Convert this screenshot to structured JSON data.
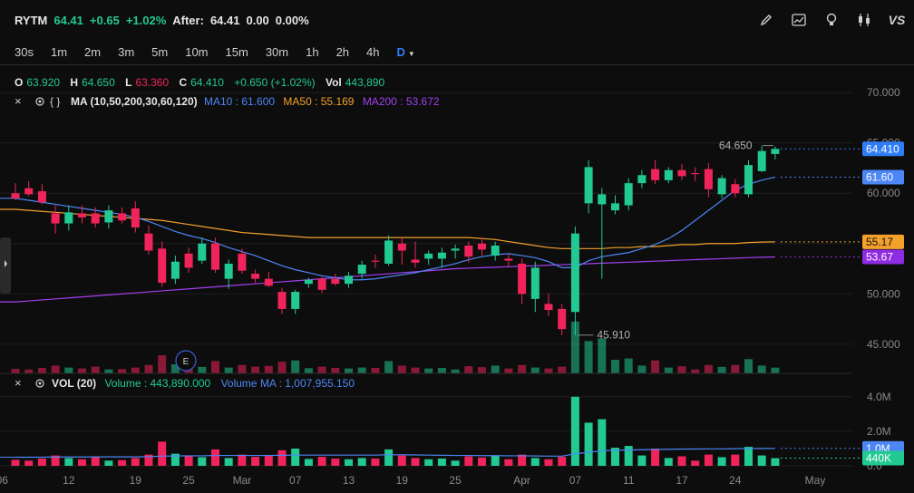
{
  "header": {
    "symbol": "RYTM",
    "last": "64.41",
    "change": "+0.65",
    "change_pct": "+1.02%",
    "after_label": "After:",
    "after_price": "64.41",
    "after_change": "0.00",
    "after_change_pct": "0.00%"
  },
  "toolbar_icons": [
    "pencil-icon",
    "chart-trend-icon",
    "lightbulb-icon",
    "candles-icon",
    "vs-icon"
  ],
  "toolbar": {
    "vs_label": "VS"
  },
  "timeframes": [
    "30s",
    "1m",
    "2m",
    "3m",
    "5m",
    "10m",
    "15m",
    "30m",
    "1h",
    "2h",
    "4h",
    "D"
  ],
  "active_timeframe": "D",
  "ohlc": {
    "o_label": "O",
    "o": "63.920",
    "h_label": "H",
    "h": "64.650",
    "l_label": "L",
    "l": "63.360",
    "c_label": "C",
    "c": "64.410",
    "chg": "+0.650 (+1.02%)",
    "vol_label": "Vol",
    "vol": "443,890"
  },
  "ma_legend": {
    "title": "MA (10,50,200,30,60,120)",
    "ma10": "MA10 : 61.600",
    "ma50": "MA50 : 55.169",
    "ma200": "MA200 : 53.672"
  },
  "vol_legend": {
    "title": "VOL (20)",
    "volume": "Volume : 443,890.000",
    "volume_ma": "Volume MA : 1,007,955.150"
  },
  "colors": {
    "up": "#22c993",
    "down": "#f0245a",
    "ma10": "#4d86f5",
    "ma50": "#f4a12c",
    "ma200": "#a33ff0",
    "last_price_tag": "#2f7df6",
    "ma10_tag": "#4d86f5",
    "ma50_tag": "#f4a12c",
    "ma200_tag": "#8f2be0"
  },
  "chart_data": {
    "type": "candlestick",
    "price_axis": {
      "ticks": [
        "70.000",
        "65.000",
        "60.000",
        "55.000",
        "50.000",
        "45.000"
      ],
      "range": [
        43,
        72
      ]
    },
    "volume_axis": {
      "ticks": [
        "4.0M",
        "2.0M",
        "0.0"
      ],
      "range": [
        0,
        4200000
      ]
    },
    "x_ticks": [
      "06",
      "12",
      "19",
      "25",
      "Mar",
      "07",
      "13",
      "19",
      "25",
      "Apr",
      "07",
      "11",
      "17",
      "24",
      "May"
    ],
    "price_tags": {
      "last": "64.410",
      "ma10": "61.60",
      "ma50": "55.17",
      "ma200": "53.67"
    },
    "volume_tags": {
      "volume_ma": "1.0M",
      "volume": "440K"
    },
    "annotations": {
      "high": "64.650",
      "low": "45.910"
    },
    "earnings_marker": "E",
    "candles": [
      {
        "o": 60.0,
        "h": 61.0,
        "l": 59.3,
        "c": 59.5,
        "v": 350000
      },
      {
        "o": 60.5,
        "h": 61.2,
        "l": 59.7,
        "c": 59.9,
        "v": 300000
      },
      {
        "o": 60.2,
        "h": 60.9,
        "l": 58.9,
        "c": 59.1,
        "v": 420000
      },
      {
        "o": 58.0,
        "h": 58.8,
        "l": 56.0,
        "c": 57.0,
        "v": 600000
      },
      {
        "o": 57.0,
        "h": 58.8,
        "l": 56.3,
        "c": 58.1,
        "v": 450000
      },
      {
        "o": 58.0,
        "h": 58.8,
        "l": 57.0,
        "c": 57.6,
        "v": 380000
      },
      {
        "o": 58.0,
        "h": 58.6,
        "l": 56.6,
        "c": 57.0,
        "v": 520000
      },
      {
        "o": 57.1,
        "h": 58.8,
        "l": 56.5,
        "c": 58.3,
        "v": 300000
      },
      {
        "o": 58.0,
        "h": 58.6,
        "l": 57.0,
        "c": 57.3,
        "v": 330000
      },
      {
        "o": 58.5,
        "h": 59.2,
        "l": 56.1,
        "c": 56.6,
        "v": 450000
      },
      {
        "o": 56.0,
        "h": 56.8,
        "l": 53.9,
        "c": 54.3,
        "v": 650000
      },
      {
        "o": 54.5,
        "h": 55.2,
        "l": 50.7,
        "c": 51.1,
        "v": 1400000
      },
      {
        "o": 51.5,
        "h": 53.8,
        "l": 51.0,
        "c": 53.2,
        "v": 700000
      },
      {
        "o": 54.0,
        "h": 54.6,
        "l": 52.1,
        "c": 52.6,
        "v": 600000
      },
      {
        "o": 53.3,
        "h": 55.6,
        "l": 53.0,
        "c": 55.0,
        "v": 500000
      },
      {
        "o": 55.0,
        "h": 55.6,
        "l": 52.1,
        "c": 52.4,
        "v": 950000
      },
      {
        "o": 51.5,
        "h": 53.4,
        "l": 50.5,
        "c": 53.0,
        "v": 450000
      },
      {
        "o": 54.0,
        "h": 54.5,
        "l": 52.0,
        "c": 52.3,
        "v": 650000
      },
      {
        "o": 52.0,
        "h": 52.4,
        "l": 51.1,
        "c": 51.5,
        "v": 520000
      },
      {
        "o": 51.5,
        "h": 52.2,
        "l": 50.7,
        "c": 50.8,
        "v": 580000
      },
      {
        "o": 50.2,
        "h": 50.6,
        "l": 48.0,
        "c": 48.5,
        "v": 900000
      },
      {
        "o": 48.5,
        "h": 50.4,
        "l": 48.0,
        "c": 50.2,
        "v": 1000000
      },
      {
        "o": 51.0,
        "h": 51.6,
        "l": 50.6,
        "c": 51.4,
        "v": 400000
      },
      {
        "o": 51.5,
        "h": 51.7,
        "l": 50.1,
        "c": 50.4,
        "v": 520000
      },
      {
        "o": 51.5,
        "h": 52.0,
        "l": 50.8,
        "c": 51.0,
        "v": 420000
      },
      {
        "o": 51.0,
        "h": 52.2,
        "l": 50.6,
        "c": 51.8,
        "v": 380000
      },
      {
        "o": 52.0,
        "h": 53.3,
        "l": 51.5,
        "c": 52.9,
        "v": 450000
      },
      {
        "o": 53.3,
        "h": 53.9,
        "l": 52.6,
        "c": 53.2,
        "v": 420000
      },
      {
        "o": 53.0,
        "h": 55.8,
        "l": 52.8,
        "c": 55.3,
        "v": 950000
      },
      {
        "o": 55.0,
        "h": 55.6,
        "l": 52.9,
        "c": 54.3,
        "v": 600000
      },
      {
        "o": 53.4,
        "h": 55.2,
        "l": 52.6,
        "c": 53.1,
        "v": 450000
      },
      {
        "o": 53.5,
        "h": 54.3,
        "l": 52.9,
        "c": 54.0,
        "v": 380000
      },
      {
        "o": 53.5,
        "h": 54.6,
        "l": 52.6,
        "c": 54.1,
        "v": 420000
      },
      {
        "o": 54.3,
        "h": 54.9,
        "l": 53.5,
        "c": 54.5,
        "v": 300000
      },
      {
        "o": 54.8,
        "h": 55.2,
        "l": 53.1,
        "c": 53.7,
        "v": 550000
      },
      {
        "o": 55.0,
        "h": 55.6,
        "l": 53.8,
        "c": 54.4,
        "v": 480000
      },
      {
        "o": 53.8,
        "h": 55.2,
        "l": 53.3,
        "c": 54.8,
        "v": 600000
      },
      {
        "o": 53.5,
        "h": 54.0,
        "l": 52.7,
        "c": 53.3,
        "v": 380000
      },
      {
        "o": 53.0,
        "h": 53.5,
        "l": 49.0,
        "c": 50.0,
        "v": 650000
      },
      {
        "o": 49.5,
        "h": 53.2,
        "l": 48.2,
        "c": 52.6,
        "v": 450000
      },
      {
        "o": 49.0,
        "h": 50.0,
        "l": 47.8,
        "c": 48.4,
        "v": 380000
      },
      {
        "o": 48.5,
        "h": 49.0,
        "l": 45.9,
        "c": 46.5,
        "v": 520000
      },
      {
        "o": 48.2,
        "h": 56.7,
        "l": 45.9,
        "c": 56.0,
        "v": 4000000
      },
      {
        "o": 59.0,
        "h": 63.3,
        "l": 58.0,
        "c": 62.6,
        "v": 2500000
      },
      {
        "o": 58.9,
        "h": 60.5,
        "l": 51.5,
        "c": 59.9,
        "v": 2700000
      },
      {
        "o": 58.3,
        "h": 59.8,
        "l": 57.9,
        "c": 59.0,
        "v": 1050000
      },
      {
        "o": 58.8,
        "h": 61.5,
        "l": 58.3,
        "c": 61.0,
        "v": 1150000
      },
      {
        "o": 61.0,
        "h": 62.3,
        "l": 60.5,
        "c": 61.8,
        "v": 600000
      },
      {
        "o": 62.4,
        "h": 63.3,
        "l": 60.9,
        "c": 61.3,
        "v": 1000000
      },
      {
        "o": 61.3,
        "h": 62.6,
        "l": 61.0,
        "c": 62.3,
        "v": 450000
      },
      {
        "o": 62.3,
        "h": 62.9,
        "l": 61.3,
        "c": 61.7,
        "v": 550000
      },
      {
        "o": 62.0,
        "h": 62.6,
        "l": 61.2,
        "c": 61.9,
        "v": 300000
      },
      {
        "o": 62.4,
        "h": 63.0,
        "l": 59.6,
        "c": 60.4,
        "v": 650000
      },
      {
        "o": 59.9,
        "h": 61.8,
        "l": 59.5,
        "c": 61.5,
        "v": 500000
      },
      {
        "o": 60.9,
        "h": 61.4,
        "l": 59.6,
        "c": 60.0,
        "v": 650000
      },
      {
        "o": 59.9,
        "h": 63.3,
        "l": 59.6,
        "c": 62.8,
        "v": 1100000
      },
      {
        "o": 62.2,
        "h": 64.7,
        "l": 62.1,
        "c": 64.2,
        "v": 600000
      },
      {
        "o": 63.9,
        "h": 64.65,
        "l": 63.36,
        "c": 64.41,
        "v": 443890
      }
    ],
    "ma10": [
      59.5,
      59.3,
      59.1,
      58.9,
      58.7,
      58.5,
      58.3,
      58.1,
      57.9,
      57.6,
      57.2,
      56.7,
      56.2,
      55.8,
      55.5,
      55.1,
      54.6,
      54.2,
      53.8,
      53.3,
      52.8,
      52.4,
      52.1,
      51.8,
      51.6,
      51.4,
      51.4,
      51.5,
      51.7,
      51.9,
      52.1,
      52.4,
      52.7,
      53.0,
      53.4,
      53.7,
      53.9,
      54.0,
      53.8,
      53.6,
      53.2,
      52.6,
      52.6,
      53.3,
      53.7,
      53.9,
      54.1,
      54.5,
      54.9,
      55.5,
      56.3,
      57.3,
      58.3,
      59.3,
      60.3,
      60.9,
      61.3,
      61.6
    ],
    "ma50": [
      58.4,
      58.3,
      58.2,
      58.1,
      58.0,
      57.9,
      57.8,
      57.7,
      57.6,
      57.5,
      57.4,
      57.3,
      57.1,
      56.9,
      56.7,
      56.5,
      56.3,
      56.1,
      56.0,
      55.9,
      55.8,
      55.7,
      55.6,
      55.6,
      55.6,
      55.6,
      55.6,
      55.6,
      55.6,
      55.6,
      55.6,
      55.6,
      55.6,
      55.6,
      55.6,
      55.5,
      55.4,
      55.2,
      55.0,
      54.8,
      54.6,
      54.5,
      54.5,
      54.5,
      54.5,
      54.6,
      54.6,
      54.7,
      54.7,
      54.8,
      54.9,
      54.9,
      55.0,
      55.0,
      55.0,
      55.1,
      55.15,
      55.17
    ],
    "ma200": [
      49.2,
      49.3,
      49.4,
      49.5,
      49.6,
      49.7,
      49.8,
      49.9,
      50.0,
      50.1,
      50.2,
      50.3,
      50.4,
      50.5,
      50.6,
      50.7,
      50.8,
      50.9,
      51.0,
      51.1,
      51.2,
      51.3,
      51.4,
      51.5,
      51.6,
      51.7,
      51.8,
      51.9,
      52.0,
      52.1,
      52.2,
      52.3,
      52.4,
      52.5,
      52.55,
      52.6,
      52.65,
      52.7,
      52.75,
      52.8,
      52.85,
      52.9,
      52.95,
      53.0,
      53.05,
      53.1,
      53.15,
      53.2,
      53.25,
      53.3,
      53.35,
      53.4,
      53.45,
      53.5,
      53.55,
      53.6,
      53.64,
      53.67
    ],
    "vol_ma": [
      500000,
      500000,
      500000,
      510000,
      510000,
      510000,
      520000,
      520000,
      520000,
      520000,
      530000,
      560000,
      570000,
      580000,
      580000,
      600000,
      600000,
      600000,
      600000,
      600000,
      610000,
      620000,
      620000,
      620000,
      620000,
      620000,
      620000,
      620000,
      640000,
      640000,
      630000,
      620000,
      610000,
      600000,
      600000,
      590000,
      590000,
      580000,
      580000,
      570000,
      560000,
      560000,
      700000,
      780000,
      870000,
      900000,
      920000,
      930000,
      950000,
      960000,
      970000,
      970000,
      980000,
      980000,
      990000,
      1000000,
      1005000,
      1007955
    ]
  }
}
